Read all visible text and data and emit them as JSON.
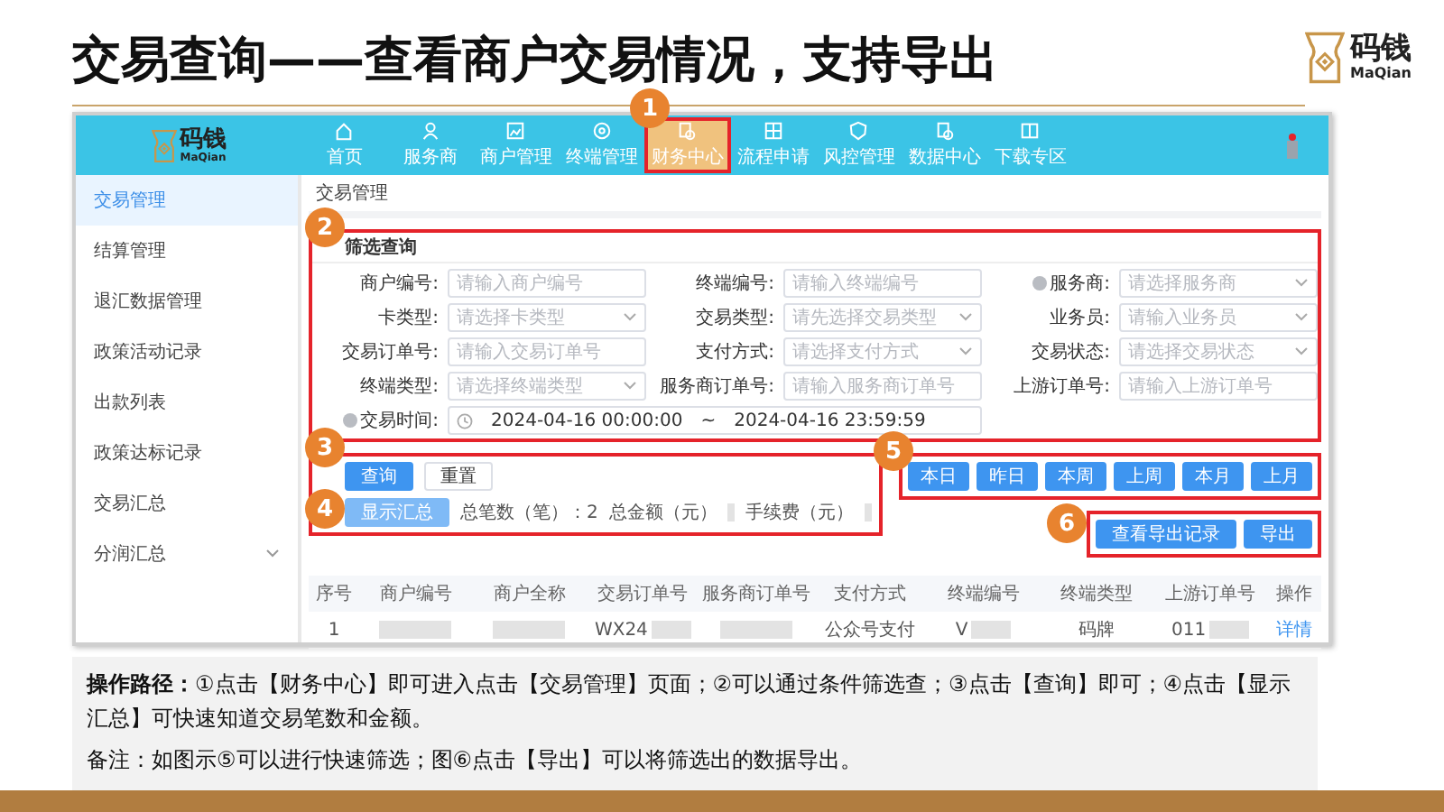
{
  "slide": {
    "title": "交易查询——查看商户交易情况，支持导出",
    "logo": {
      "name": "码钱",
      "latin": "MaQian"
    }
  },
  "app": {
    "logo": {
      "name": "码钱",
      "latin": "MaQian"
    },
    "nav": [
      {
        "label": "首页",
        "selected": false
      },
      {
        "label": "服务商",
        "selected": false
      },
      {
        "label": "商户管理",
        "selected": false
      },
      {
        "label": "终端管理",
        "selected": false
      },
      {
        "label": "财务中心",
        "selected": true,
        "marker": "1"
      },
      {
        "label": "流程申请",
        "selected": false
      },
      {
        "label": "风控管理",
        "selected": false
      },
      {
        "label": "数据中心",
        "selected": false
      },
      {
        "label": "下载专区",
        "selected": false
      }
    ],
    "sidebar": [
      {
        "label": "交易管理",
        "selected": true,
        "expandable": false
      },
      {
        "label": "结算管理",
        "selected": false,
        "expandable": false
      },
      {
        "label": "退汇数据管理",
        "selected": false,
        "expandable": false
      },
      {
        "label": "政策活动记录",
        "selected": false,
        "expandable": false
      },
      {
        "label": "出款列表",
        "selected": false,
        "expandable": false
      },
      {
        "label": "政策达标记录",
        "selected": false,
        "expandable": false
      },
      {
        "label": "交易汇总",
        "selected": false,
        "expandable": false
      },
      {
        "label": "分润汇总",
        "selected": false,
        "expandable": true
      }
    ],
    "breadcrumb": "交易管理",
    "filter": {
      "marker": "2",
      "title": "筛选查询",
      "fields": [
        {
          "label": "商户编号:",
          "placeholder": "请输入商户编号",
          "kind": "input",
          "help": false
        },
        {
          "label": "终端编号:",
          "placeholder": "请输入终端编号",
          "kind": "input",
          "help": false
        },
        {
          "label": "服务商:",
          "placeholder": "请选择服务商",
          "kind": "select",
          "help": true
        },
        {
          "label": "卡类型:",
          "placeholder": "请选择卡类型",
          "kind": "select",
          "help": false
        },
        {
          "label": "交易类型:",
          "placeholder": "请先选择交易类型",
          "kind": "select",
          "help": false
        },
        {
          "label": "业务员:",
          "placeholder": "请输入业务员",
          "kind": "select",
          "help": false
        },
        {
          "label": "交易订单号:",
          "placeholder": "请输入交易订单号",
          "kind": "input",
          "help": false
        },
        {
          "label": "支付方式:",
          "placeholder": "请选择支付方式",
          "kind": "select",
          "help": false
        },
        {
          "label": "交易状态:",
          "placeholder": "请选择交易状态",
          "kind": "select",
          "help": false
        },
        {
          "label": "终端类型:",
          "placeholder": "请选择终端类型",
          "kind": "select",
          "help": false
        },
        {
          "label": "服务商订单号:",
          "placeholder": "请输入服务商订单号",
          "kind": "input",
          "help": false
        },
        {
          "label": "上游订单号:",
          "placeholder": "请输入上游订单号",
          "kind": "input",
          "help": false
        }
      ],
      "time": {
        "label": "交易时间:",
        "help": true,
        "start": "2024-04-16 00:00:00",
        "separator": "~",
        "end": "2024-04-16 23:59:59"
      }
    },
    "actions": {
      "markers": [
        "3",
        "4"
      ],
      "query": "查询",
      "reset": "重置",
      "summary_button": "显示汇总",
      "summary": [
        "总笔数（笔）：2",
        "总金额（元）",
        "手续费（元）"
      ]
    },
    "quick": {
      "marker": "5",
      "buttons": [
        "本日",
        "昨日",
        "本周",
        "上周",
        "本月",
        "上月"
      ]
    },
    "export": {
      "marker": "6",
      "buttons": [
        "查看导出记录",
        "导出"
      ]
    },
    "table": {
      "columns": [
        "序号",
        "商户编号",
        "商户全称",
        "交易订单号",
        "服务商订单号",
        "支付方式",
        "终端编号",
        "终端类型",
        "上游订单号",
        "操作"
      ],
      "rows": [
        {
          "index": "1",
          "order_no": "WX24",
          "pay_method": "公众号支付",
          "terminal_no": "V",
          "terminal_type": "码牌",
          "upstream_no": "011",
          "action": "详情"
        }
      ]
    }
  },
  "note": {
    "paragraphs": [
      "**操作路径：**①点击【财务中心】即可进入点击【交易管理】页面；②可以通过条件筛选查；③点击【查询】即可；④点击【显示汇总】可快速知道交易笔数和金额。",
      "备注：如图示⑤可以进行快速筛选；图⑥点击【导出】可以将筛选出的数据导出。"
    ]
  }
}
